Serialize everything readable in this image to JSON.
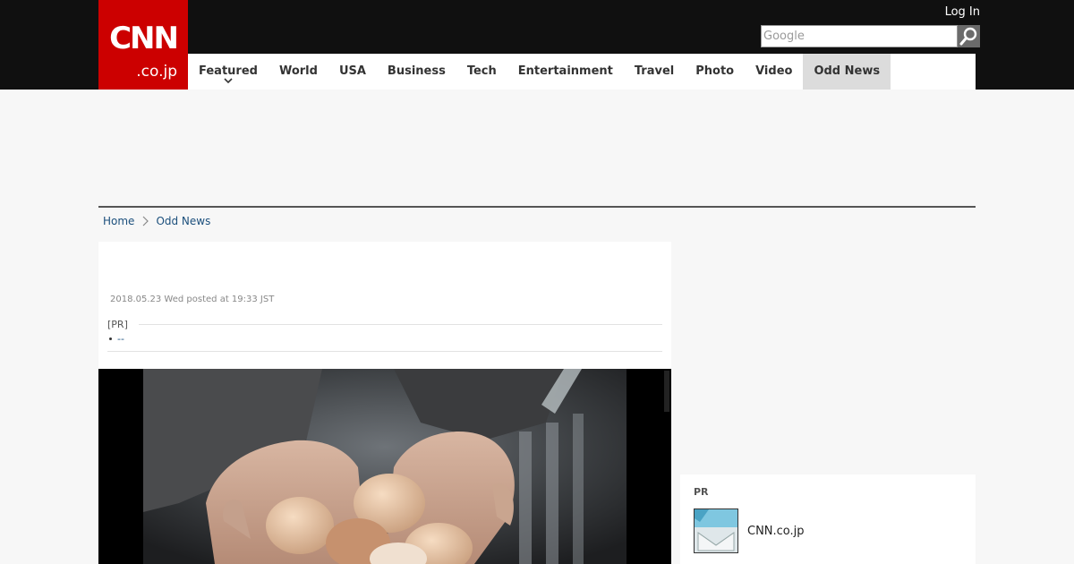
{
  "header": {
    "logo_main": "CNN",
    "logo_sub": ".co.jp",
    "login_label": "Log In",
    "search": {
      "placeholder": "Google",
      "value": ""
    },
    "colors": {
      "bar": "#101010",
      "logo": "#cc0000",
      "active_nav": "#dcdcdc"
    }
  },
  "nav": {
    "items": [
      {
        "label": "Featured",
        "has_dropdown": true
      },
      {
        "label": "World"
      },
      {
        "label": "USA"
      },
      {
        "label": "Business"
      },
      {
        "label": "Tech"
      },
      {
        "label": "Entertainment"
      },
      {
        "label": "Travel"
      },
      {
        "label": "Photo"
      },
      {
        "label": "Video"
      },
      {
        "label": "Odd News",
        "active": true
      }
    ]
  },
  "breadcrumb": {
    "home": "Home",
    "current": "Odd News"
  },
  "article": {
    "posted": "2018.05.23 Wed posted at 19:33 JST",
    "pr_label": "[PR]",
    "pr_link": "--",
    "photo_icon": "hands-holding-eggs-photo"
  },
  "sidebar": {
    "pr_label": "PR",
    "pr_item_text": "CNN.co.jp",
    "pr_item_icon": "envelope-icon"
  }
}
